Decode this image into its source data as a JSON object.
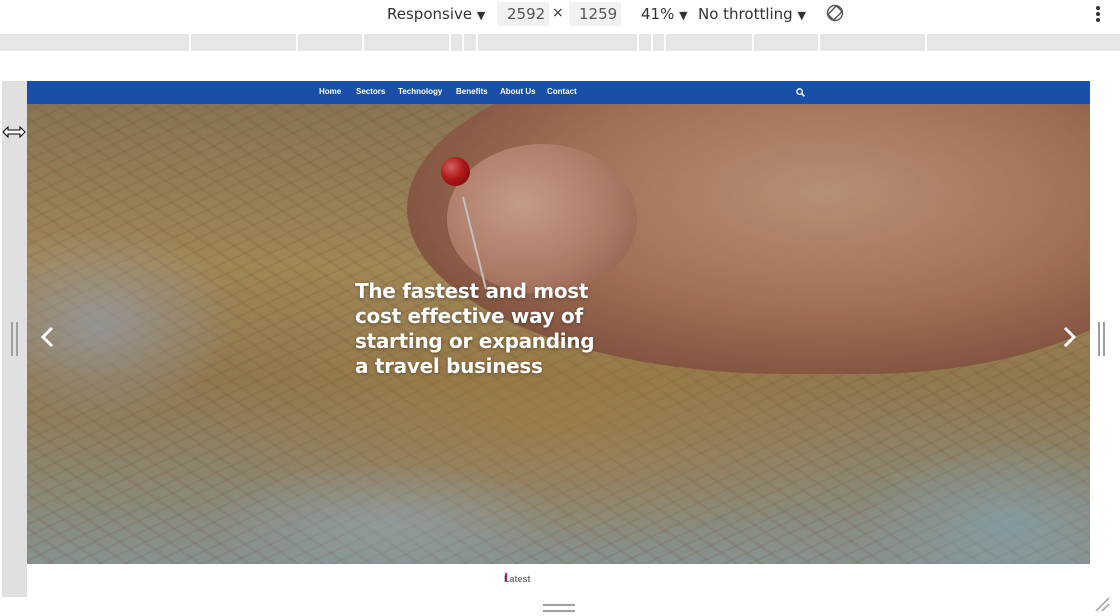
{
  "toolbar": {
    "device": "Responsive",
    "width": "2592",
    "height": "1259",
    "zoom": "41%",
    "throttling": "No throttling",
    "rotate_icon": "rotate-icon",
    "more_icon": "more-vertical-icon"
  },
  "nav": {
    "items": [
      "Home",
      "Sectors",
      "Technology",
      "Benefits",
      "About Us",
      "Contact"
    ],
    "search_icon": "search-icon",
    "color": "#1a4fa8"
  },
  "hero": {
    "title": "The fastest and most cost effective way of starting or expanding a travel business",
    "prev_icon": "chevron-left-icon",
    "next_icon": "chevron-right-icon"
  },
  "below": {
    "text": "Latest"
  }
}
